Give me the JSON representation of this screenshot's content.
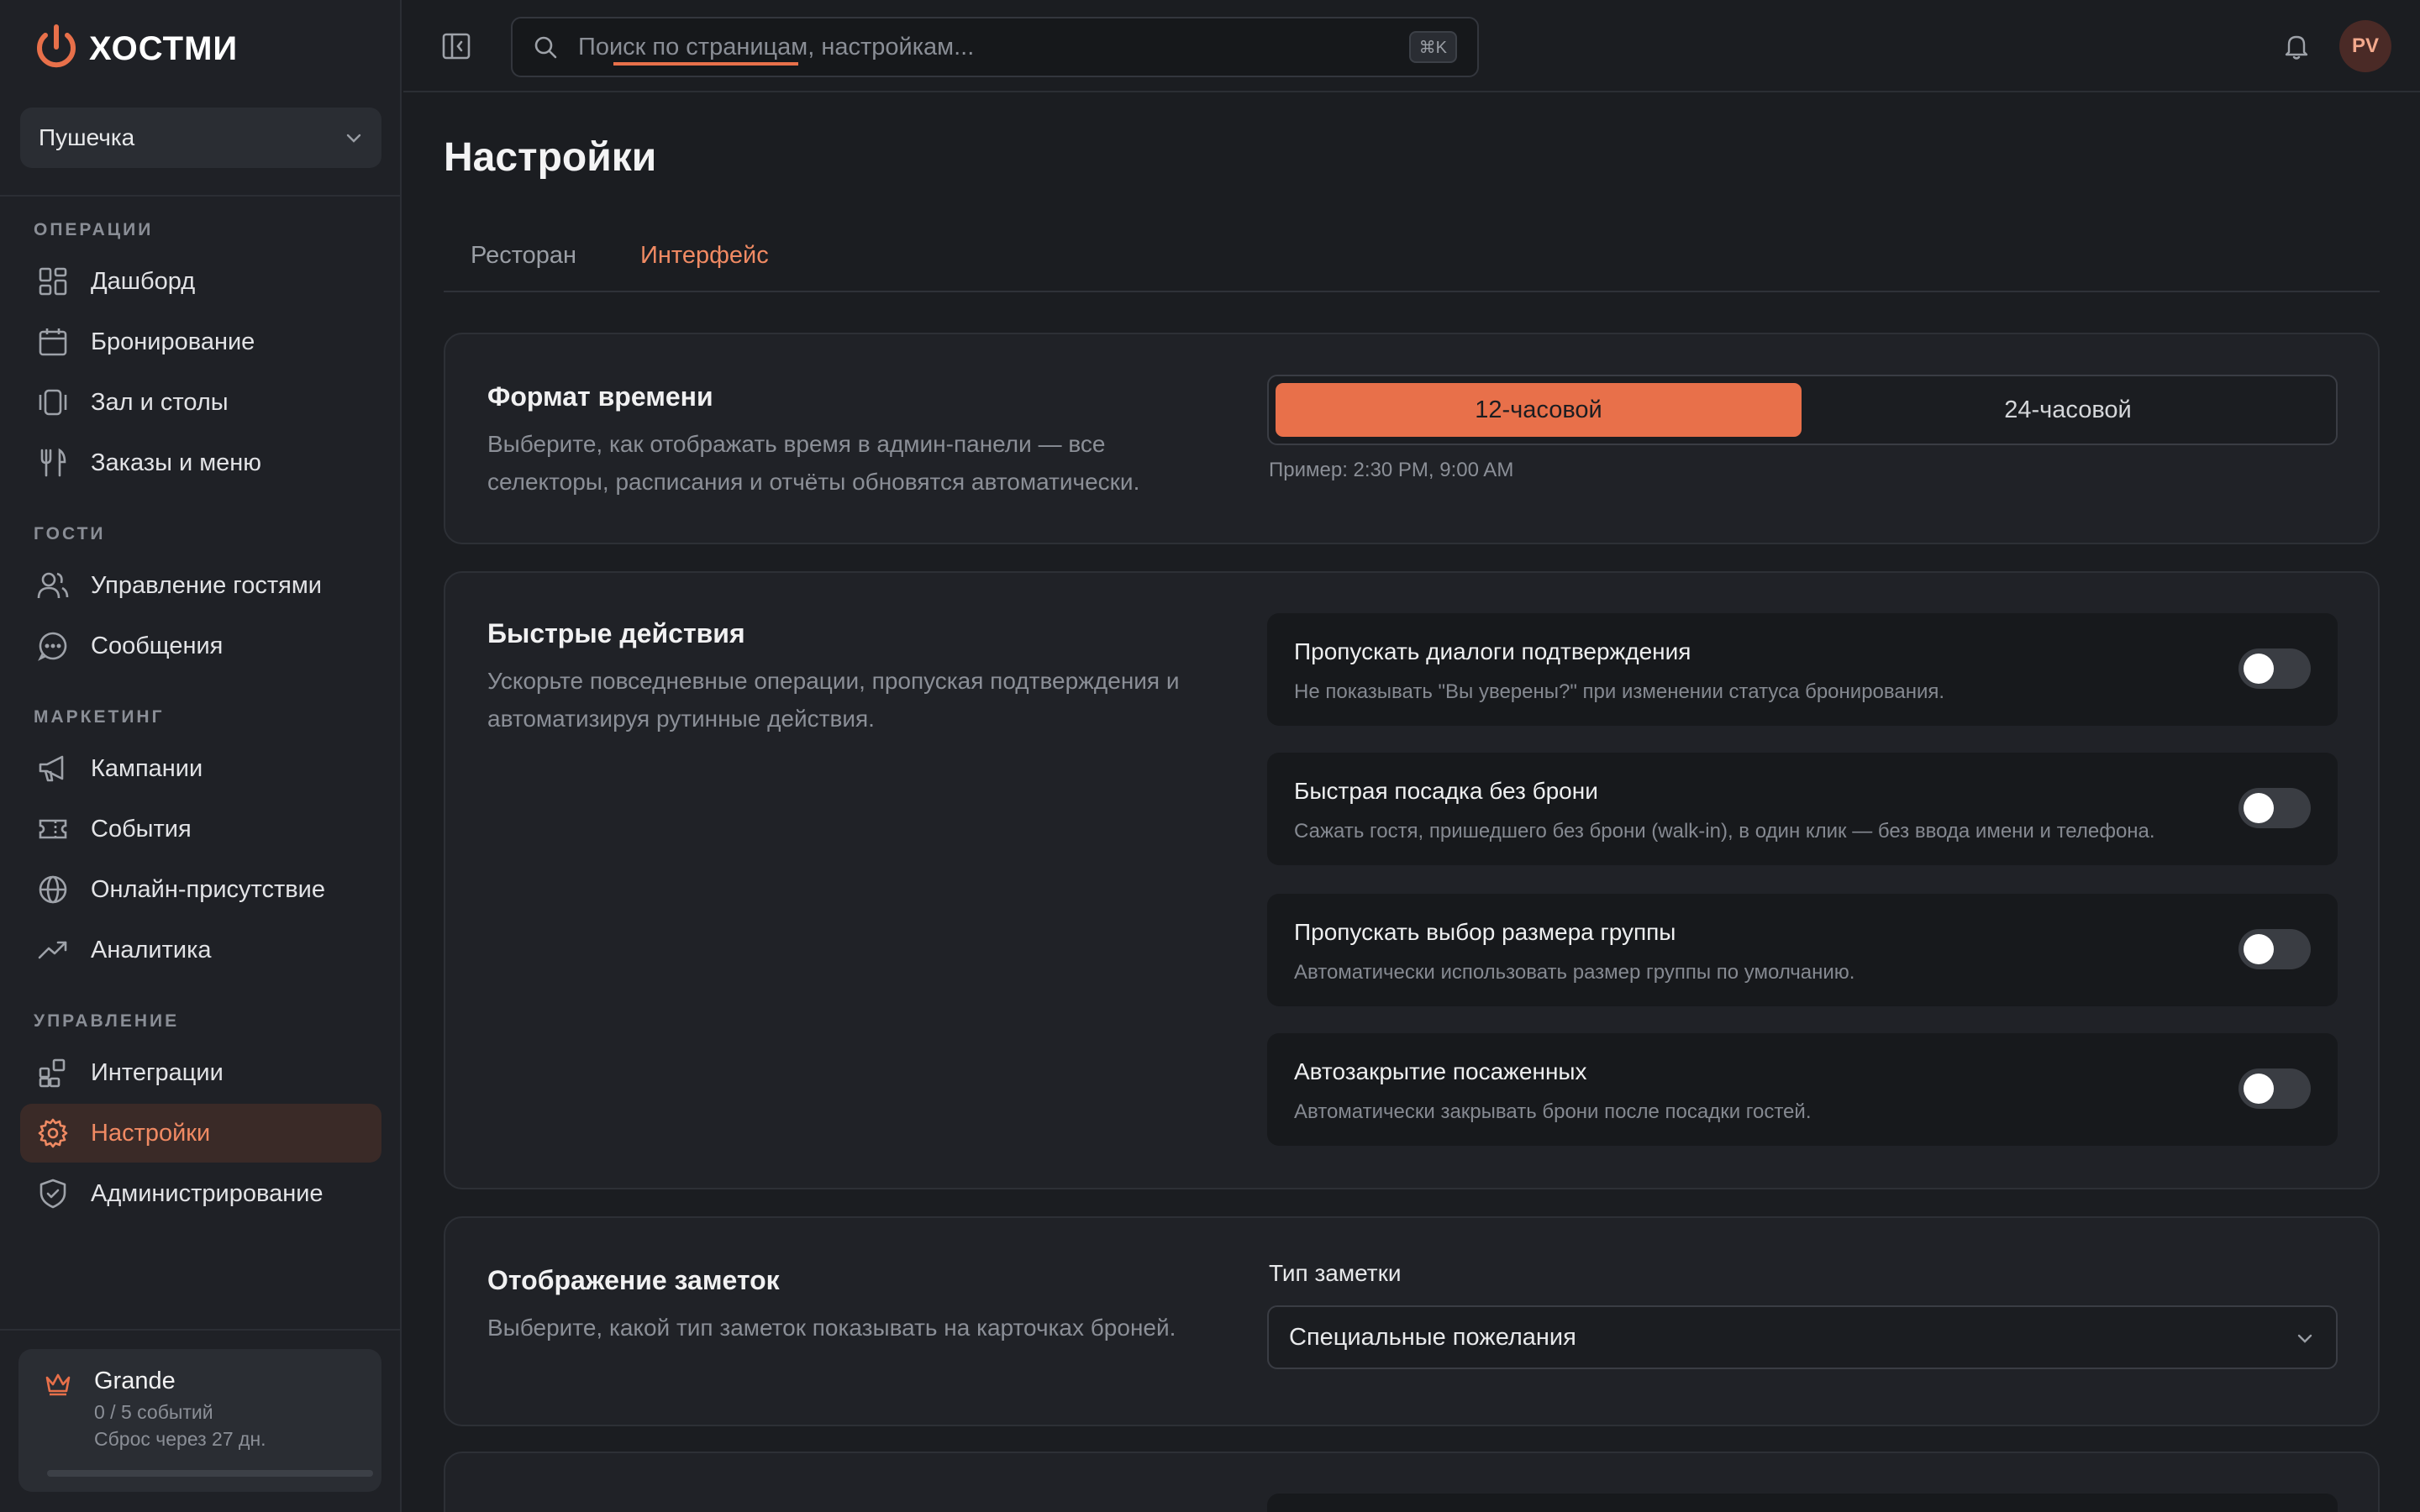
{
  "brand": {
    "name": "ХОСТМИ",
    "accent": "#e8704a"
  },
  "restaurant": {
    "name": "Пушечка"
  },
  "sidebar": {
    "sections": [
      {
        "label": "ОПЕРАЦИИ",
        "items": [
          {
            "label": "Дашборд",
            "icon": "dashboard-icon"
          },
          {
            "label": "Бронирование",
            "icon": "calendar-icon"
          },
          {
            "label": "Зал и столы",
            "icon": "tables-icon"
          },
          {
            "label": "Заказы и меню",
            "icon": "utensils-icon"
          }
        ]
      },
      {
        "label": "ГОСТИ",
        "items": [
          {
            "label": "Управление гостями",
            "icon": "users-icon"
          },
          {
            "label": "Сообщения",
            "icon": "message-icon"
          }
        ]
      },
      {
        "label": "МАРКЕТИНГ",
        "items": [
          {
            "label": "Кампании",
            "icon": "megaphone-icon"
          },
          {
            "label": "События",
            "icon": "ticket-icon"
          },
          {
            "label": "Онлайн-присутствие",
            "icon": "globe-icon"
          },
          {
            "label": "Аналитика",
            "icon": "trend-icon"
          }
        ]
      },
      {
        "label": "УПРАВЛЕНИЕ",
        "items": [
          {
            "label": "Интеграции",
            "icon": "integrations-icon"
          },
          {
            "label": "Настройки",
            "icon": "gear-icon",
            "active": true
          },
          {
            "label": "Администрирование",
            "icon": "shield-icon"
          }
        ]
      }
    ]
  },
  "plan": {
    "name": "Grande",
    "usage": "0 / 5 событий",
    "reset": "Сброс через 27 дн.",
    "progress": 0
  },
  "topbar": {
    "search_placeholder": "Поиск по страницам, настройкам...",
    "shortcut": "⌘K",
    "avatar_initials": "PV"
  },
  "page": {
    "title": "Настройки",
    "tabs": [
      {
        "label": "Ресторан"
      },
      {
        "label": "Интерфейс",
        "active": true
      }
    ]
  },
  "time_format": {
    "title": "Формат времени",
    "description": "Выберите, как отображать время в админ-панели — все селекторы, расписания и отчёты обновятся автоматически.",
    "options": [
      "12-часовой",
      "24-часовой"
    ],
    "selected": "12-часовой",
    "example": "Пример: 2:30 PM, 9:00 AM"
  },
  "quick_actions": {
    "title": "Быстрые действия",
    "description": "Ускорьте повседневные операции, пропуская подтверждения и автоматизируя рутинные действия.",
    "items": [
      {
        "title": "Пропускать диалоги подтверждения",
        "description": "Не показывать \"Вы уверены?\" при изменении статуса бронирования.",
        "enabled": false
      },
      {
        "title": "Быстрая посадка без брони",
        "description": "Сажать гостя, пришедшего без брони (walk-in), в один клик — без ввода имени и телефона.",
        "enabled": false
      },
      {
        "title": "Пропускать выбор размера группы",
        "description": "Автоматически использовать размер группы по умолчанию.",
        "enabled": false
      },
      {
        "title": "Автозакрытие посаженных",
        "description": "Автоматически закрывать брони после посадки гостей.",
        "enabled": false
      }
    ]
  },
  "notes_display": {
    "title": "Отображение заметок",
    "description": "Выберите, какой тип заметок показывать на карточках броней.",
    "field_label": "Тип заметки",
    "value": "Специальные пожелания"
  }
}
